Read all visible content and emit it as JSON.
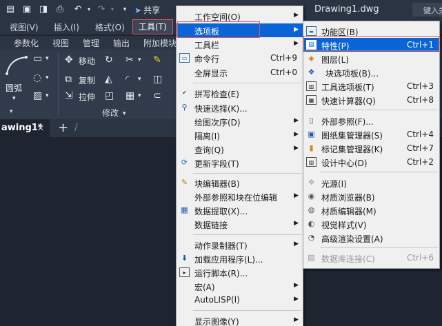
{
  "title_bar": {
    "share_label": "共享",
    "document_title": "Drawing1.dwg",
    "search_placeholder": "键入关"
  },
  "menubar": {
    "items": [
      "视图(V)",
      "插入(I)",
      "格式(O)",
      "工具(T)"
    ],
    "active": "工具(T)"
  },
  "ribbon_tabs": [
    "参数化",
    "视图",
    "管理",
    "输出",
    "附加模块"
  ],
  "ribbon": {
    "arc_label": "圆弧",
    "move_label": "移动",
    "copy_label": "复制",
    "stretch_label": "拉伸",
    "modify_panel_label": "修改"
  },
  "drawing_tabs": {
    "active_tab": "awing1*"
  },
  "tools_menu": {
    "items": [
      {
        "label": "工作空间(O)",
        "shortcut": "",
        "submenu": true,
        "icon": ""
      },
      {
        "label": "选项板",
        "shortcut": "",
        "submenu": true,
        "icon": "",
        "highlighted": true
      },
      {
        "label": "工具栏",
        "shortcut": "",
        "submenu": true,
        "icon": ""
      },
      {
        "label": "命令行",
        "shortcut": "Ctrl+9",
        "submenu": false,
        "icon": "command-line-icon"
      },
      {
        "label": "全屏显示",
        "shortcut": "Ctrl+0",
        "submenu": false,
        "icon": ""
      },
      {
        "label": "拼写检查(E)",
        "shortcut": "",
        "submenu": false,
        "icon": "spell-check-icon"
      },
      {
        "label": "快速选择(K)...",
        "shortcut": "",
        "submenu": false,
        "icon": "quick-select-icon"
      },
      {
        "label": "绘图次序(D)",
        "shortcut": "",
        "submenu": true,
        "icon": ""
      },
      {
        "label": "隔离(I)",
        "shortcut": "",
        "submenu": true,
        "icon": ""
      },
      {
        "label": "查询(Q)",
        "shortcut": "",
        "submenu": true,
        "icon": ""
      },
      {
        "label": "更新字段(T)",
        "shortcut": "",
        "submenu": false,
        "icon": "update-field-icon"
      },
      {
        "label": "块编辑器(B)",
        "shortcut": "",
        "submenu": false,
        "icon": "block-editor-icon"
      },
      {
        "label": "外部参照和块在位编辑",
        "shortcut": "",
        "submenu": true,
        "icon": ""
      },
      {
        "label": "数据提取(X)...",
        "shortcut": "",
        "submenu": false,
        "icon": "data-extraction-icon"
      },
      {
        "label": "数据链接",
        "shortcut": "",
        "submenu": true,
        "icon": ""
      },
      {
        "label": "动作录制器(T)",
        "shortcut": "",
        "submenu": true,
        "icon": ""
      },
      {
        "label": "加载应用程序(L)...",
        "shortcut": "",
        "submenu": false,
        "icon": "load-app-icon"
      },
      {
        "label": "运行脚本(R)...",
        "shortcut": "",
        "submenu": false,
        "icon": "run-script-icon"
      },
      {
        "label": "宏(A)",
        "shortcut": "",
        "submenu": true,
        "icon": ""
      },
      {
        "label": "AutoLISP(I)",
        "shortcut": "",
        "submenu": true,
        "icon": ""
      },
      {
        "label": "显示图像(Y)",
        "shortcut": "",
        "submenu": true,
        "icon": ""
      }
    ]
  },
  "palettes_submenu": {
    "items": [
      {
        "label": "功能区(B)",
        "shortcut": "",
        "icon": "ribbon-icon"
      },
      {
        "label": "特性(P)",
        "shortcut": "Ctrl+1",
        "icon": "properties-icon",
        "highlighted": true
      },
      {
        "label": "图层(L)",
        "shortcut": "",
        "icon": "layers-icon"
      },
      {
        "label": "块选项板(B)...",
        "shortcut": "",
        "icon": "block-palette-icon"
      },
      {
        "label": "工具选项板(T)",
        "shortcut": "Ctrl+3",
        "icon": "tool-palettes-icon"
      },
      {
        "label": "快速计算器(Q)",
        "shortcut": "Ctrl+8",
        "icon": "calculator-icon"
      },
      {
        "label": "外部参照(F)...",
        "shortcut": "",
        "icon": "xref-icon"
      },
      {
        "label": "图纸集管理器(S)",
        "shortcut": "Ctrl+4",
        "icon": "sheet-set-icon"
      },
      {
        "label": "标记集管理器(K)",
        "shortcut": "Ctrl+7",
        "icon": "markup-set-icon"
      },
      {
        "label": "设计中心(D)",
        "shortcut": "Ctrl+2",
        "icon": "design-center-icon"
      },
      {
        "label": "光源(I)",
        "shortcut": "",
        "icon": "lights-icon"
      },
      {
        "label": "材质浏览器(B)",
        "shortcut": "",
        "icon": "materials-browser-icon"
      },
      {
        "label": "材质编辑器(M)",
        "shortcut": "",
        "icon": "materials-editor-icon"
      },
      {
        "label": "视觉样式(V)",
        "shortcut": "",
        "icon": "visual-styles-icon"
      },
      {
        "label": "高级渲染设置(A)",
        "shortcut": "",
        "icon": "render-settings-icon"
      },
      {
        "label": "数据库连接(C)",
        "shortcut": "Ctrl+6",
        "icon": "dbconnect-icon",
        "disabled": true
      }
    ]
  },
  "colors": {
    "highlight": "#0a64d6",
    "annotation_box": "#e0555a",
    "dark_bg": "#1e2530"
  }
}
